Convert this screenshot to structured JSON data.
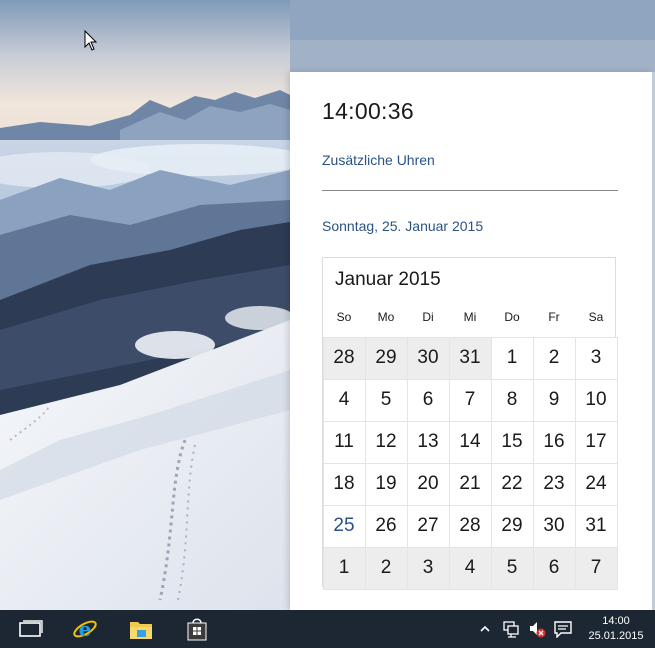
{
  "flyout": {
    "time": "14:00:36",
    "extra_clocks_link": "Zusätzliche Uhren",
    "long_date": "Sonntag, 25. Januar 2015"
  },
  "calendar": {
    "month_title": "Januar 2015",
    "weekdays": [
      "So",
      "Mo",
      "Di",
      "Mi",
      "Do",
      "Fr",
      "Sa"
    ],
    "weeks": [
      [
        "28",
        "29",
        "30",
        "31",
        "1",
        "2",
        "3"
      ],
      [
        "4",
        "5",
        "6",
        "7",
        "8",
        "9",
        "10"
      ],
      [
        "11",
        "12",
        "13",
        "14",
        "15",
        "16",
        "17"
      ],
      [
        "18",
        "19",
        "20",
        "21",
        "22",
        "23",
        "24"
      ],
      [
        "25",
        "26",
        "27",
        "28",
        "29",
        "30",
        "31"
      ],
      [
        "1",
        "2",
        "3",
        "4",
        "5",
        "6",
        "7"
      ]
    ],
    "today": "25"
  },
  "taskbar": {
    "pinned": [
      {
        "name": "task-view-icon"
      },
      {
        "name": "internet-explorer-icon"
      },
      {
        "name": "file-explorer-icon"
      },
      {
        "name": "store-icon"
      }
    ],
    "tray": {
      "icons": [
        "chevron-up-icon",
        "network-icon",
        "volume-muted-icon",
        "action-center-icon"
      ],
      "clock_time": "14:00",
      "clock_date": "25.01.2015"
    }
  },
  "colors": {
    "accent_link": "#2a5384",
    "taskbar_bg": "#1d2734",
    "other_month_bg": "#ededed"
  }
}
